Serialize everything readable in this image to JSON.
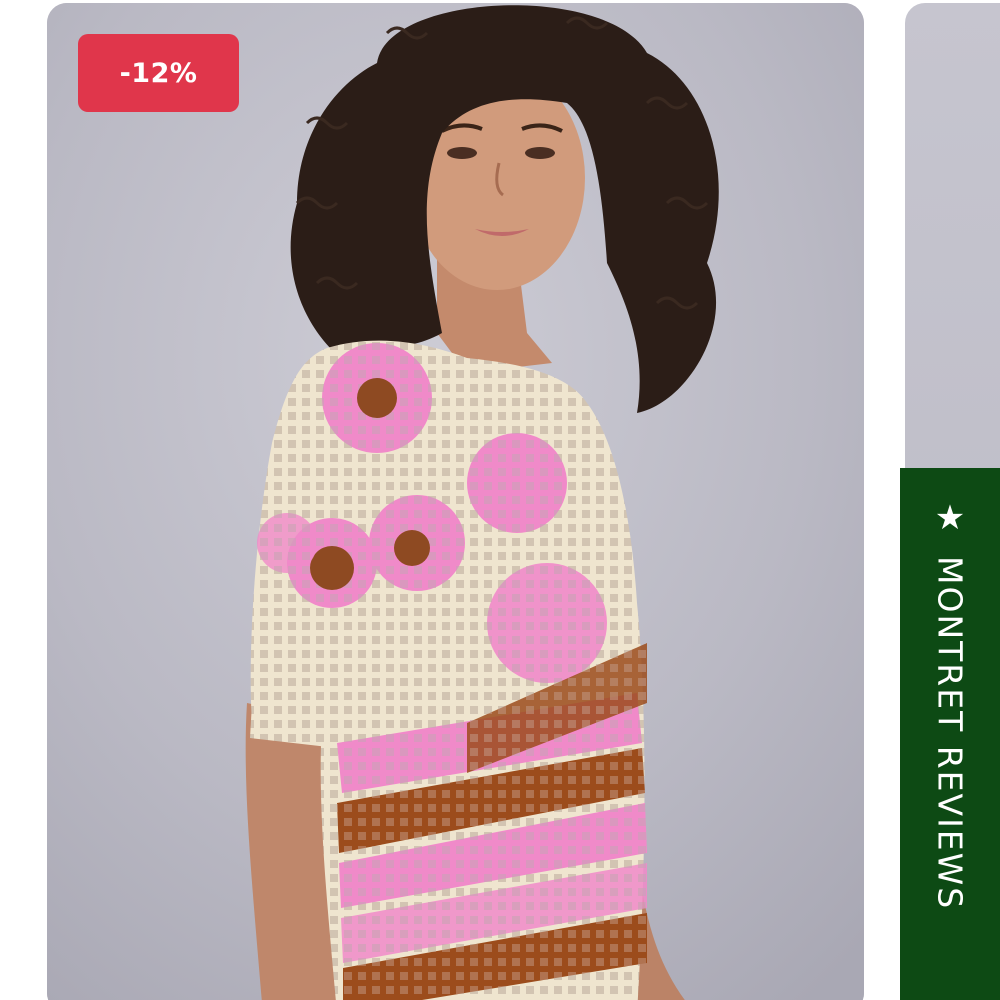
{
  "product_card": {
    "badge_text": "-12%",
    "image_alt": "Model wearing crochet top with pink, cream and brown stripes"
  },
  "reviews_tab": {
    "label": "MONTRET REVIEWS",
    "icon": "star-icon"
  },
  "colors": {
    "badge": "#e0364b",
    "reviews_tab": "#0d4a14",
    "background_backdrop": "#bdbcc6"
  }
}
